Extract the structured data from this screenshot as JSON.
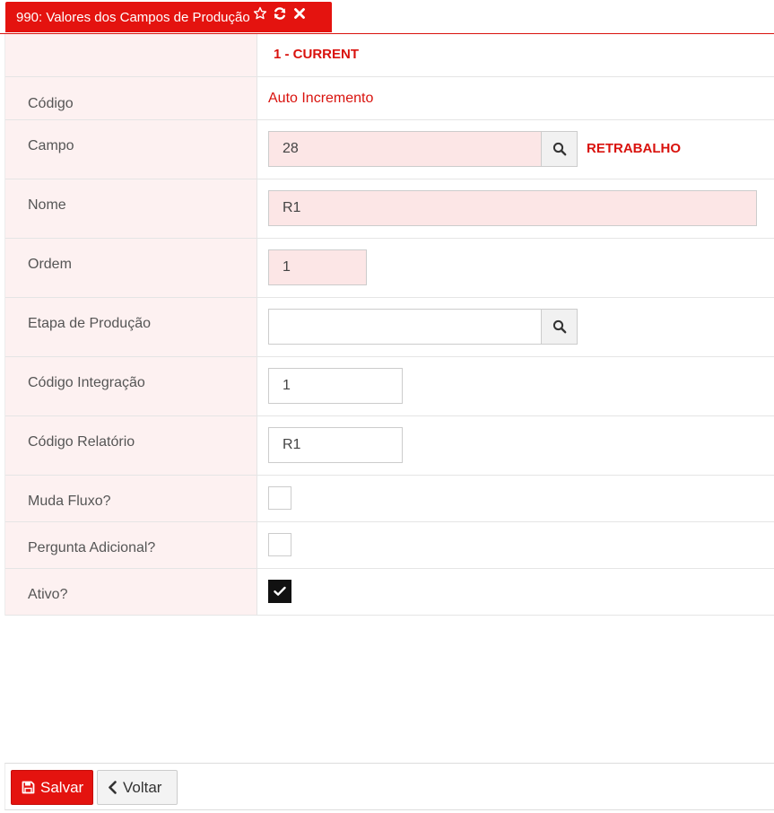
{
  "tab": {
    "title": "990: Valores dos Campos de Produção",
    "icons": [
      "star-icon",
      "refresh-icon",
      "close-icon"
    ]
  },
  "header_row": {
    "record_label": "1 - CURRENT"
  },
  "fields": {
    "codigo": {
      "label": "Código",
      "value": "Auto Incremento"
    },
    "campo": {
      "label": "Campo",
      "value": "28",
      "lookup_text": "RETRABALHO"
    },
    "nome": {
      "label": "Nome",
      "value": "R1"
    },
    "ordem": {
      "label": "Ordem",
      "value": "1"
    },
    "etapa": {
      "label": "Etapa de Produção",
      "value": ""
    },
    "codigo_integracao": {
      "label": "Código Integração",
      "value": "1"
    },
    "codigo_relatorio": {
      "label": "Código Relatório",
      "value": "R1"
    },
    "muda_fluxo": {
      "label": "Muda Fluxo?",
      "checked": false
    },
    "pergunta_adicional": {
      "label": "Pergunta Adicional?",
      "checked": false
    },
    "ativo": {
      "label": "Ativo?",
      "checked": true
    }
  },
  "footer": {
    "save_label": "Salvar",
    "back_label": "Voltar"
  },
  "colors": {
    "accent": "#e4130f",
    "label_bg": "#fdf1f1",
    "required_bg": "#fce6e6"
  }
}
